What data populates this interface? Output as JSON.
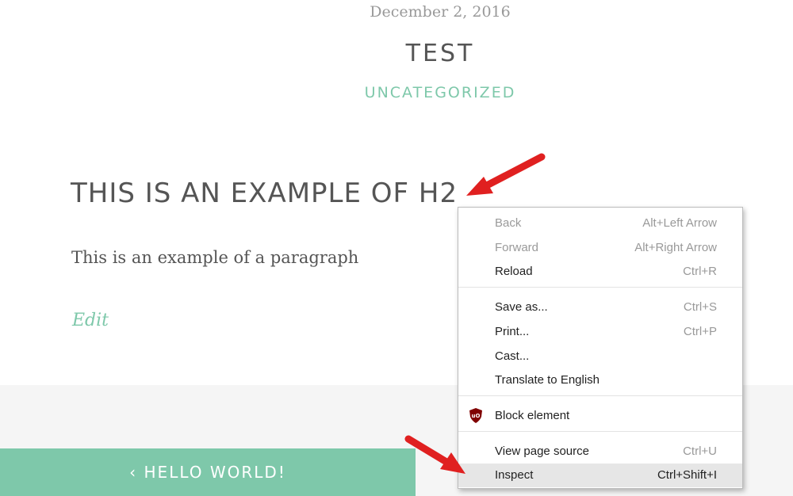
{
  "post": {
    "date": "December 2, 2016",
    "title": "TEST",
    "category": "UNCATEGORIZED",
    "h2": "THIS IS AN EXAMPLE OF H2",
    "paragraph": "This is an example of a paragraph",
    "edit": "Edit"
  },
  "nav": {
    "prev": "‹ HELLO WORLD!"
  },
  "context_menu": {
    "items": [
      {
        "label": "Back",
        "shortcut": "Alt+Left Arrow"
      },
      {
        "label": "Forward",
        "shortcut": "Alt+Right Arrow"
      },
      {
        "label": "Reload",
        "shortcut": "Ctrl+R"
      },
      {
        "label": "Save as...",
        "shortcut": "Ctrl+S"
      },
      {
        "label": "Print...",
        "shortcut": "Ctrl+P"
      },
      {
        "label": "Cast..."
      },
      {
        "label": "Translate to English"
      },
      {
        "label": "Block element",
        "icon": "ublock-icon"
      },
      {
        "label": "View page source",
        "shortcut": "Ctrl+U"
      },
      {
        "label": "Inspect",
        "shortcut": "Ctrl+Shift+I"
      }
    ]
  },
  "colors": {
    "accent": "#7ec8aa",
    "arrow": "#e02020",
    "ublock": "#800000"
  }
}
